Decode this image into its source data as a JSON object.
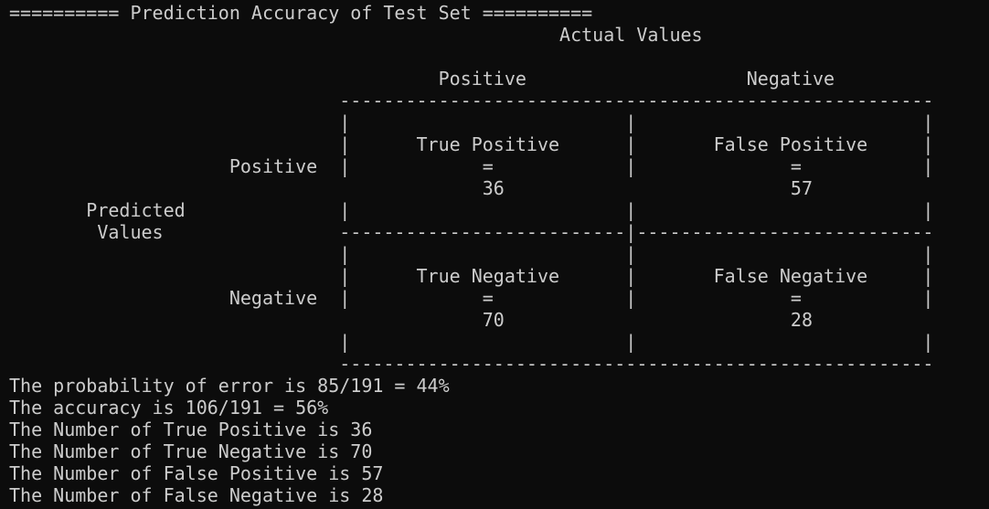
{
  "terminal": {
    "lines": [
      "========== Prediction Accuracy of Test Set ==========",
      "                                                  Actual Values",
      "",
      "                                       Positive                    Negative",
      "                              ------------------------------------------------------",
      "                              |                         |                          |",
      "                              |      True Positive      |       False Positive     |",
      "                    Positive  |            =            |              =           |",
      "                                           36                          57",
      "       Predicted              |                         |                          |",
      "        Values                --------------------------|---------------------------",
      "                              |                         |                          |",
      "                              |      True Negative      |       False Negative     |",
      "                    Negative  |            =            |              =           |",
      "                                           70                          28",
      "                              |                         |                          |",
      "                              ------------------------------------------------------",
      "The probability of error is 85/191 = 44%",
      "The accuracy is 106/191 = 56%",
      "The Number of True Positive is 36",
      "The Number of True Negative is 70",
      "The Number of False Positive is 57",
      "The Number of False Negative is 28"
    ]
  },
  "colors": {
    "background": "#0c0c0c",
    "foreground": "#cccccc"
  }
}
